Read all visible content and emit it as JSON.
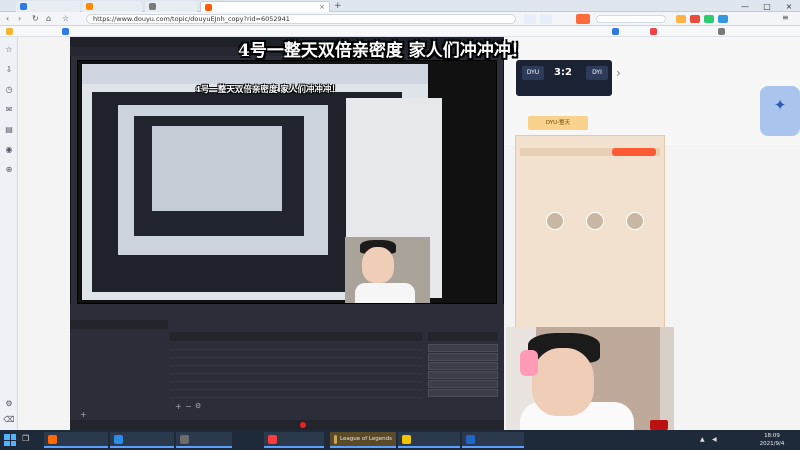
{
  "browser": {
    "tabs": [
      {
        "label": "",
        "color": "#2d7be5"
      },
      {
        "label": "",
        "color": "#ff8a00"
      },
      {
        "label": "",
        "color": "#7a7a7a"
      },
      {
        "label": "",
        "color": "#ff5a00"
      }
    ],
    "address": "https://www.douyu.com/topic/douyuEJnh_copy?rid=6052941",
    "bookmarks": []
  },
  "obs": {
    "title": "",
    "menu": [],
    "scene_header": "",
    "sources_header": "",
    "controls_header": "",
    "scene_item": "",
    "sources": [],
    "controls": [],
    "status": ""
  },
  "overlay": {
    "banner": "4号一整天双倍亲密度 家人们冲冲冲！",
    "banner_inner": "4号一整天双倍亲密度 家人们冲冲冲！"
  },
  "stream_page": {
    "team_left": "DYU",
    "team_right": "DYI",
    "score": "3:2",
    "room_button_1": "",
    "room_button_2": "DYU-整天",
    "chat_lines": []
  },
  "webcam": {
    "label_large": "",
    "label_small": ""
  },
  "taskbar": {
    "items": [
      {
        "label": "",
        "color": "#ff6a00"
      },
      {
        "label": "",
        "color": "#2a8ce6"
      },
      {
        "label": "",
        "color": "#6c6c6c"
      },
      {
        "label": "",
        "color": "#ff3b3b"
      },
      {
        "label": "League of Legends",
        "color": "#c9a35a"
      },
      {
        "label": "",
        "color": "#f5c400"
      },
      {
        "label": "",
        "color": "#2066c8"
      }
    ],
    "time": "18:09",
    "date": "2021/9/4"
  }
}
